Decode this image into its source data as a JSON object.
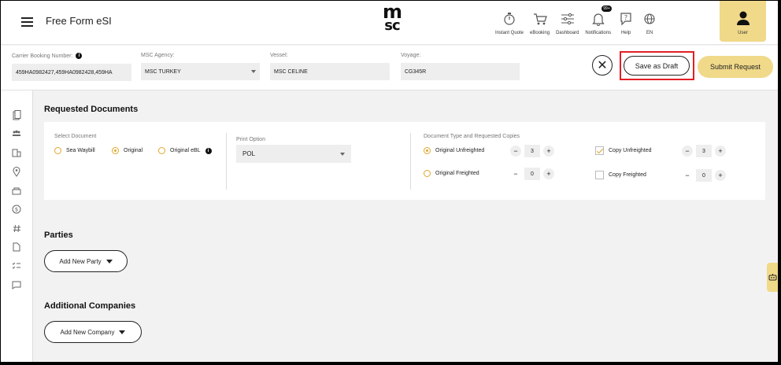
{
  "header": {
    "app_title": "Free Form eSI",
    "logo_top": "m",
    "logo_bottom": "sc",
    "nav": [
      {
        "label": "Instant Quote",
        "icon": "stopwatch-icon"
      },
      {
        "label": "eBooking",
        "icon": "cart-icon"
      },
      {
        "label": "Dashboard",
        "icon": "sliders-icon"
      },
      {
        "label": "Notifications",
        "icon": "bell-icon",
        "badge": "99+"
      },
      {
        "label": "Help",
        "icon": "help-icon"
      },
      {
        "label": "EN",
        "icon": "globe-icon"
      }
    ],
    "user_label": "User"
  },
  "booking": {
    "carrier_label": "Carrier Booking Number:",
    "carrier_value": "459HA0982427,459HA0982428,459HA",
    "agency_label": "MSC Agency:",
    "agency_value": "MSC TURKEY",
    "vessel_label": "Vessel:",
    "vessel_value": "MSC CELINE",
    "voyage_label": "Voyage:",
    "voyage_value": "CG345R",
    "close_symbol": "✕",
    "save_draft": "Save as Draft",
    "submit": "Submit Request"
  },
  "requested": {
    "title": "Requested Documents",
    "select_label": "Select Document",
    "options": [
      {
        "label": "Sea Waybill",
        "selected": false
      },
      {
        "label": "Original",
        "selected": true
      },
      {
        "label": "Original eBL",
        "selected": false
      }
    ],
    "print_label": "Print Option",
    "print_value": "POL",
    "doc_type_label": "Document Type and Requested Copies",
    "original_unfreighted": {
      "label": "Original Unfreighted",
      "value": "3",
      "selected": true
    },
    "original_freighted": {
      "label": "Original Freighted",
      "value": "0",
      "selected": false
    },
    "copy_unfreighted": {
      "label": "Copy Unfreighted",
      "value": "3",
      "checked": true
    },
    "copy_freighted": {
      "label": "Copy Freighted",
      "value": "0",
      "checked": false
    },
    "minus": "−",
    "plus": "+"
  },
  "parties": {
    "title": "Parties",
    "add_button": "Add New Party"
  },
  "companies": {
    "title": "Additional Companies",
    "add_button": "Add New Company"
  },
  "colors": {
    "accent": "#f0d989",
    "radio": "#e0a72a",
    "highlight": "#e21f26"
  }
}
